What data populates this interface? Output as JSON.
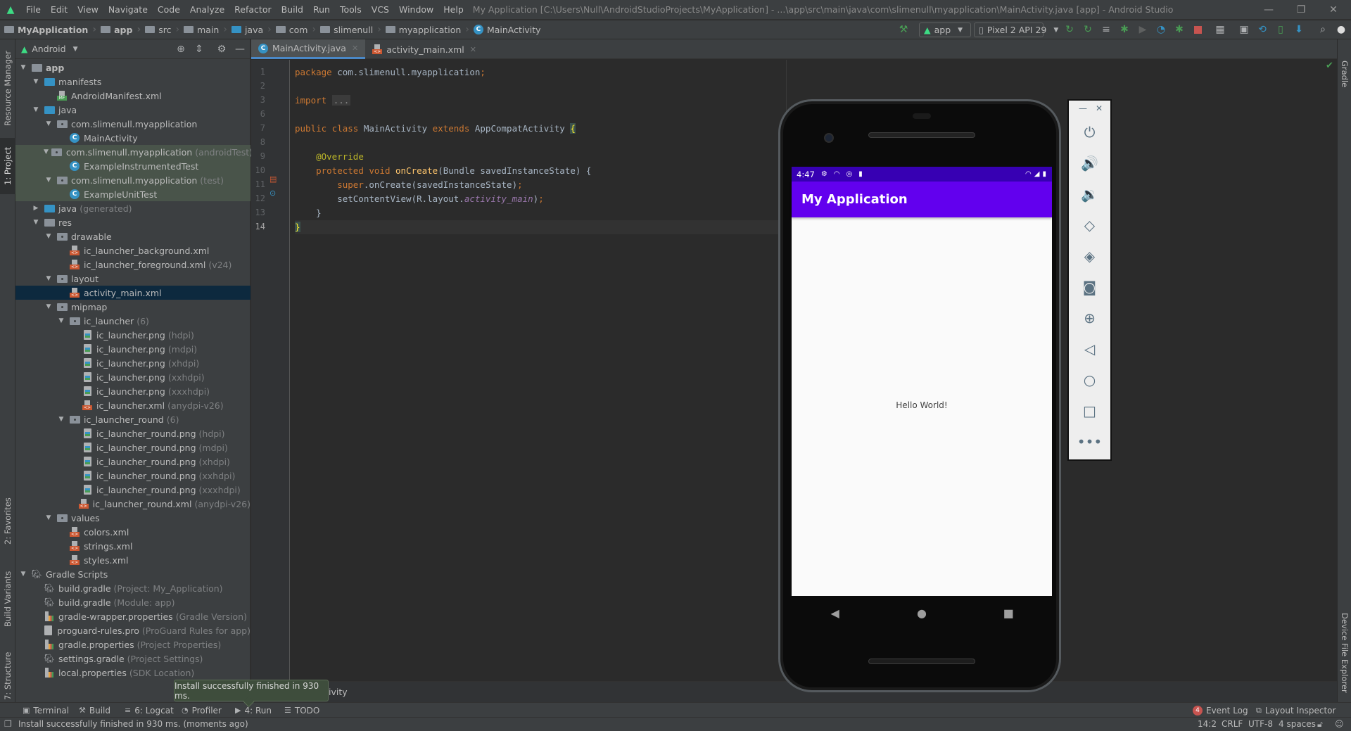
{
  "app": {
    "window_title": "My Application [C:\\Users\\Null\\AndroidStudioProjects\\MyApplication] - ...\\app\\src\\main\\java\\com\\slimenull\\myapplication\\MainActivity.java [app] - Android Studio",
    "menu": [
      "File",
      "Edit",
      "View",
      "Navigate",
      "Code",
      "Analyze",
      "Refactor",
      "Build",
      "Run",
      "Tools",
      "VCS",
      "Window",
      "Help"
    ],
    "window_controls": {
      "minimize": "—",
      "restore": "❐",
      "close": "✕"
    }
  },
  "breadcrumb": [
    "MyApplication",
    "app",
    "src",
    "main",
    "java",
    "com",
    "slimenull",
    "myapplication",
    "MainActivity"
  ],
  "toolbar": {
    "run_config": "app",
    "device": "Pixel 2 API 29",
    "icons": [
      "hammer-icon",
      "apply-changes-icon",
      "apply-code-changes-icon",
      "sync-icon",
      "debug-icon",
      "attach-debugger-icon",
      "profile-icon",
      "attach-debug-process-icon",
      "stop-icon",
      "project-structure-icon",
      "avd-manager-icon",
      "gradle-sync-icon",
      "device-manager-icon",
      "sdk-manager-icon",
      "search-icon",
      "user-icon"
    ],
    "stop_color": "#c75450"
  },
  "left_strip": {
    "tabs": [
      "Resource Manager",
      "1: Project",
      "2: Favorites",
      "Build Variants",
      "7: Structure"
    ]
  },
  "right_strip": {
    "tabs": [
      "Gradle",
      "Device File Explorer"
    ]
  },
  "project_panel": {
    "view": "Android",
    "tree": [
      {
        "label": "app",
        "suffix": "",
        "depth": 0,
        "expanded": true,
        "icon": "module",
        "bold": true
      },
      {
        "label": "manifests",
        "suffix": "",
        "depth": 1,
        "expanded": true,
        "icon": "folder-blue"
      },
      {
        "label": "AndroidManifest.xml",
        "suffix": "",
        "depth": 2,
        "icon": "manifest"
      },
      {
        "label": "java",
        "suffix": "",
        "depth": 1,
        "expanded": true,
        "icon": "folder-blue"
      },
      {
        "label": "com.slimenull.myapplication",
        "suffix": "",
        "depth": 2,
        "expanded": true,
        "icon": "package"
      },
      {
        "label": "MainActivity",
        "suffix": "",
        "depth": 3,
        "icon": "class"
      },
      {
        "label": "com.slimenull.myapplication",
        "suffix": "(androidTest)",
        "depth": 2,
        "expanded": true,
        "icon": "package",
        "test": true
      },
      {
        "label": "ExampleInstrumentedTest",
        "suffix": "",
        "depth": 3,
        "icon": "class",
        "test": true
      },
      {
        "label": "com.slimenull.myapplication",
        "suffix": "(test)",
        "depth": 2,
        "expanded": true,
        "icon": "package",
        "test": true
      },
      {
        "label": "ExampleUnitTest",
        "suffix": "",
        "depth": 3,
        "icon": "class",
        "test": true
      },
      {
        "label": "java",
        "suffix": "(generated)",
        "depth": 1,
        "expanded": false,
        "icon": "folder-generated"
      },
      {
        "label": "res",
        "suffix": "",
        "depth": 1,
        "expanded": true,
        "icon": "folder-res"
      },
      {
        "label": "drawable",
        "suffix": "",
        "depth": 2,
        "expanded": true,
        "icon": "package"
      },
      {
        "label": "ic_launcher_background.xml",
        "suffix": "",
        "depth": 3,
        "icon": "xml"
      },
      {
        "label": "ic_launcher_foreground.xml",
        "suffix": "(v24)",
        "depth": 3,
        "icon": "xml"
      },
      {
        "label": "layout",
        "suffix": "",
        "depth": 2,
        "expanded": true,
        "icon": "package"
      },
      {
        "label": "activity_main.xml",
        "suffix": "",
        "depth": 3,
        "icon": "xml",
        "selected": true
      },
      {
        "label": "mipmap",
        "suffix": "",
        "depth": 2,
        "expanded": true,
        "icon": "package"
      },
      {
        "label": "ic_launcher",
        "suffix": "(6)",
        "depth": 3,
        "expanded": true,
        "icon": "package"
      },
      {
        "label": "ic_launcher.png",
        "suffix": "(hdpi)",
        "depth": 4,
        "icon": "png"
      },
      {
        "label": "ic_launcher.png",
        "suffix": "(mdpi)",
        "depth": 4,
        "icon": "png"
      },
      {
        "label": "ic_launcher.png",
        "suffix": "(xhdpi)",
        "depth": 4,
        "icon": "png"
      },
      {
        "label": "ic_launcher.png",
        "suffix": "(xxhdpi)",
        "depth": 4,
        "icon": "png"
      },
      {
        "label": "ic_launcher.png",
        "suffix": "(xxxhdpi)",
        "depth": 4,
        "icon": "png"
      },
      {
        "label": "ic_launcher.xml",
        "suffix": "(anydpi-v26)",
        "depth": 4,
        "icon": "xml"
      },
      {
        "label": "ic_launcher_round",
        "suffix": "(6)",
        "depth": 3,
        "expanded": true,
        "icon": "package"
      },
      {
        "label": "ic_launcher_round.png",
        "suffix": "(hdpi)",
        "depth": 4,
        "icon": "png"
      },
      {
        "label": "ic_launcher_round.png",
        "suffix": "(mdpi)",
        "depth": 4,
        "icon": "png"
      },
      {
        "label": "ic_launcher_round.png",
        "suffix": "(xhdpi)",
        "depth": 4,
        "icon": "png"
      },
      {
        "label": "ic_launcher_round.png",
        "suffix": "(xxhdpi)",
        "depth": 4,
        "icon": "png"
      },
      {
        "label": "ic_launcher_round.png",
        "suffix": "(xxxhdpi)",
        "depth": 4,
        "icon": "png"
      },
      {
        "label": "ic_launcher_round.xml",
        "suffix": "(anydpi-v26)",
        "depth": 4,
        "icon": "xml"
      },
      {
        "label": "values",
        "suffix": "",
        "depth": 2,
        "expanded": true,
        "icon": "package"
      },
      {
        "label": "colors.xml",
        "suffix": "",
        "depth": 3,
        "icon": "xml"
      },
      {
        "label": "strings.xml",
        "suffix": "",
        "depth": 3,
        "icon": "xml"
      },
      {
        "label": "styles.xml",
        "suffix": "",
        "depth": 3,
        "icon": "xml"
      },
      {
        "label": "Gradle Scripts",
        "suffix": "",
        "depth": 0,
        "expanded": true,
        "icon": "gradle"
      },
      {
        "label": "build.gradle",
        "suffix": "(Project: My_Application)",
        "depth": 1,
        "icon": "gradle"
      },
      {
        "label": "build.gradle",
        "suffix": "(Module: app)",
        "depth": 1,
        "icon": "gradle"
      },
      {
        "label": "gradle-wrapper.properties",
        "suffix": "(Gradle Version)",
        "depth": 1,
        "icon": "properties"
      },
      {
        "label": "proguard-rules.pro",
        "suffix": "(ProGuard Rules for app)",
        "depth": 1,
        "icon": "text"
      },
      {
        "label": "gradle.properties",
        "suffix": "(Project Properties)",
        "depth": 1,
        "icon": "properties"
      },
      {
        "label": "settings.gradle",
        "suffix": "(Project Settings)",
        "depth": 1,
        "icon": "gradle"
      },
      {
        "label": "local.properties",
        "suffix": "(SDK Location)",
        "depth": 1,
        "icon": "properties"
      }
    ]
  },
  "editor": {
    "tabs": [
      {
        "label": "MainActivity.java",
        "active": true,
        "icon": "class"
      },
      {
        "label": "activity_main.xml",
        "active": false,
        "icon": "xml"
      }
    ],
    "lines": [
      {
        "n": "1",
        "html": "<span class=\"kw\">package</span> com.slimenull.myapplication<span class=\"kw\">;</span>"
      },
      {
        "n": "2",
        "html": ""
      },
      {
        "n": "3",
        "html": "<span class=\"kw\">import</span> <span class=\"fold\">...</span>"
      },
      {
        "n": "6",
        "html": ""
      },
      {
        "n": "7",
        "html": "<span class=\"kw\">public class</span> MainActivity <span class=\"kw\">extends</span> AppCompatActivity <span class=\"brace-hl\">{</span>"
      },
      {
        "n": "8",
        "html": ""
      },
      {
        "n": "9",
        "html": "    <span class=\"ann\">@Override</span>"
      },
      {
        "n": "10",
        "html": "    <span class=\"kw\">protected void</span> <span class=\"fn\">onCreate</span>(Bundle savedInstanceState) {"
      },
      {
        "n": "11",
        "html": "        <span class=\"kw\">super</span>.onCreate(savedInstanceState)<span class=\"kw\">;</span>"
      },
      {
        "n": "12",
        "html": "        setContentView(R.layout.<span class=\"field\">activity_main</span>)<span class=\"kw\">;</span>"
      },
      {
        "n": "13",
        "html": "    }"
      },
      {
        "n": "14",
        "html": "<span class=\"brace-hl\">}</span>"
      }
    ],
    "current_line": "14",
    "breadcrumb_tail": "ivity"
  },
  "emulator": {
    "status_time": "4:47",
    "app_title": "My Application",
    "content_text": "Hello World!",
    "colors": {
      "status_bar": "#3700b3",
      "app_bar": "#6200ee"
    },
    "side_panel": {
      "top": [
        "minimize-icon",
        "close-icon"
      ],
      "buttons": [
        "power-icon",
        "volume-up-icon",
        "volume-down-icon",
        "rotate-left-icon",
        "rotate-right-icon",
        "screenshot-icon",
        "zoom-icon",
        "back-icon",
        "home-icon",
        "overview-icon",
        "more-icon"
      ]
    }
  },
  "bottom_tools": {
    "left": [
      {
        "label": "Terminal",
        "icon": "terminal-icon"
      },
      {
        "label": "Build",
        "icon": "hammer-icon"
      },
      {
        "label": "6: Logcat",
        "icon": "logcat-icon"
      },
      {
        "label": "Profiler",
        "icon": "profiler-icon"
      },
      {
        "label": "4: Run",
        "icon": "run-icon"
      },
      {
        "label": "TODO",
        "icon": "todo-icon"
      }
    ],
    "right": [
      {
        "label": "Event Log",
        "badge": "4"
      },
      {
        "label": "Layout Inspector",
        "icon": "layout-inspector-icon"
      }
    ]
  },
  "balloon": "Install successfully finished in 930 ms.",
  "status": {
    "message": "Install successfully finished in 930 ms. (moments ago)",
    "caret": "14:2",
    "line_sep": "CRLF",
    "encoding": "UTF-8",
    "indent": "4 spaces"
  }
}
